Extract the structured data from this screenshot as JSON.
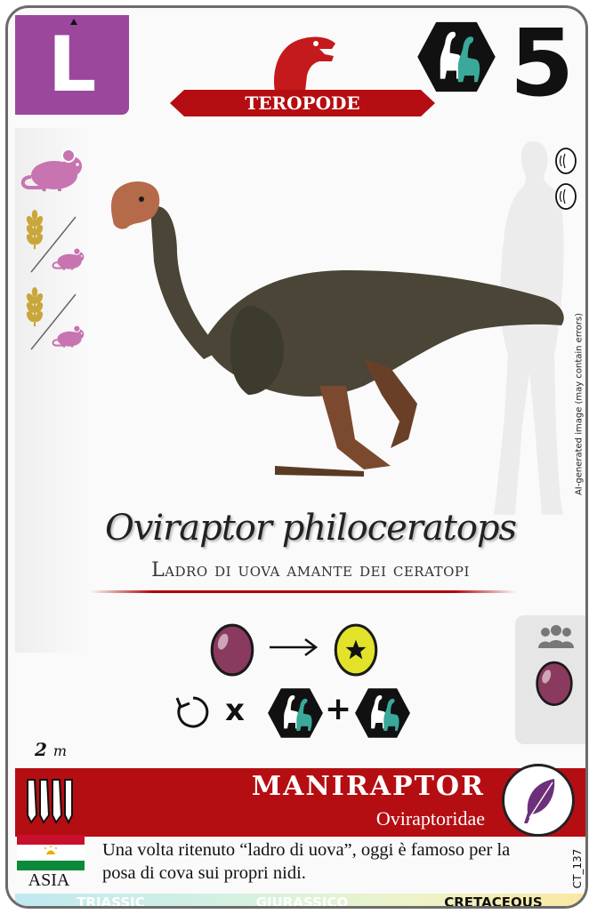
{
  "card": {
    "letter": "L",
    "group": "TEROPODE",
    "cost": "5",
    "scientific_name": "Oviraptor philoceratops",
    "common_name": "Ladro di uova amante dei ceratopi",
    "ai_note": "AI-generated image (may contain errors)",
    "size_value": "2",
    "size_unit": "m",
    "clade": "MANIRAPTOR",
    "family": "Oviraptoridae",
    "region": "ASIA",
    "description": "Una volta ritenuto “ladro di uova”, oggi è famoso per la posa di cova sui propri nidi.",
    "card_id": "CT_137",
    "periods": [
      "TRIASSIC",
      "GIURASSICO",
      "CRETACEOUS"
    ],
    "active_period": "CRETACEOUS"
  },
  "icons": {
    "diet": [
      "mouse-icon",
      "wheat-or-mouse-icon",
      "wheat-or-mouse-icon"
    ],
    "top_right": "sauropod-pair-icon",
    "habitat": [
      "egg-icon",
      "egg-icon"
    ],
    "group_icon": "theropod-head-icon",
    "ability": [
      "egg-icon",
      "arrow-right-icon",
      "star-egg-icon",
      "repeat-icon",
      "sauropod-pair-icon",
      "sauropod-pair-icon"
    ],
    "side_panel": [
      "group-icon",
      "egg-icon"
    ],
    "band": [
      "claws-icon",
      "feather-icon"
    ],
    "flag": "tajikistan-flag-icon"
  },
  "ability": {
    "times": "x",
    "plus": "+"
  },
  "colors": {
    "accent_purple": "#9b479c",
    "group_red": "#b50e12",
    "diet_pink": "#c774b0",
    "egg_purple": "#8a3a5e",
    "star_egg_yellow": "#e3e22a",
    "sauropod_teal": "#3aa89a"
  }
}
